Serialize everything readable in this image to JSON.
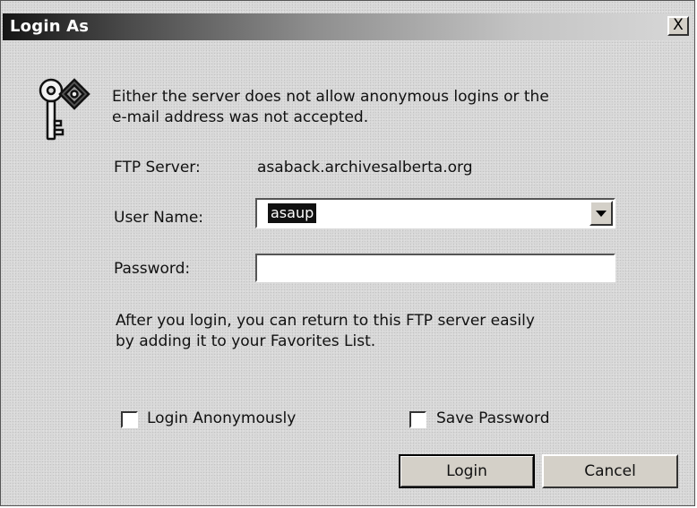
{
  "window": {
    "title": "Login As",
    "close_label": "X"
  },
  "icon": "key-icon",
  "message": {
    "line1": "Either the server does not allow anonymous logins or the",
    "line2": "e-mail address was not accepted."
  },
  "ftp_server": {
    "label": "FTP Server:",
    "value": "asaback.archivesalberta.org"
  },
  "user_name": {
    "label": "User Name:",
    "value": "asaup"
  },
  "password": {
    "label": "Password:",
    "value": ""
  },
  "info": {
    "line1": "After you login, you can return to this FTP server easily",
    "line2": "by adding it to your Favorites List."
  },
  "checkboxes": {
    "login_anonymously": {
      "label": "Login Anonymously",
      "checked": false
    },
    "save_password": {
      "label": "Save Password",
      "checked": false
    }
  },
  "buttons": {
    "login": "Login",
    "cancel": "Cancel"
  }
}
